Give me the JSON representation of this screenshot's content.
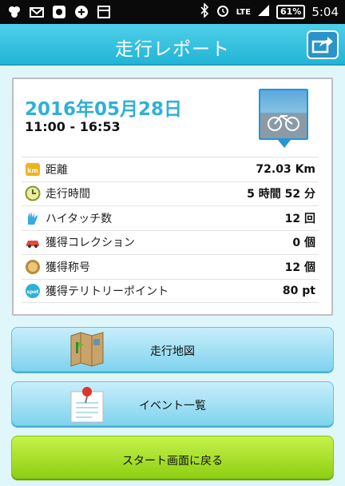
{
  "status_bar": {
    "network": "LTE",
    "battery": "61%",
    "clock": "5:04"
  },
  "header": {
    "title": "走行レポート"
  },
  "report": {
    "date": "2016年05月28日",
    "time_range": "11:00 - 16:53",
    "stats": [
      {
        "icon": "km-icon",
        "label": "距離",
        "value": "72.03 Km"
      },
      {
        "icon": "clock-icon",
        "label": "走行時間",
        "value": "5 時間 52 分"
      },
      {
        "icon": "high-five-icon",
        "label": "ハイタッチ数",
        "value": "12 回"
      },
      {
        "icon": "car-icon",
        "label": "獲得コレクション",
        "value": "0 個"
      },
      {
        "icon": "medal-icon",
        "label": "獲得称号",
        "value": "12 個"
      },
      {
        "icon": "spot-icon",
        "label": "獲得テリトリーポイント",
        "value": "80 pt"
      }
    ]
  },
  "buttons": {
    "map": "走行地図",
    "events": "イベント一覧",
    "back_to_start": "スタート画面に戻る"
  },
  "colors": {
    "header": "#2bbbe0",
    "date_accent": "#2fb0d6",
    "button_blue": "#8fd8f0",
    "button_green": "#a6dd1f"
  }
}
